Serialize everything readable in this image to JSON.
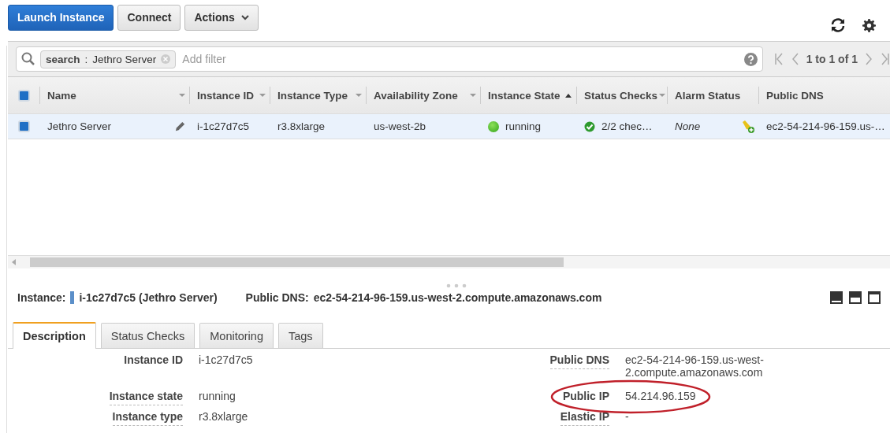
{
  "toolbar": {
    "buttons": [
      {
        "label": "Launch Instance",
        "kind": "primary"
      },
      {
        "label": "Connect",
        "kind": "plain"
      },
      {
        "label": "Actions",
        "kind": "dropdown"
      }
    ]
  },
  "filter": {
    "chip": {
      "key": "search",
      "separator": ":",
      "value": "Jethro Server"
    },
    "placeholder": "Add filter",
    "pagination": "1 to 1 of 1"
  },
  "table": {
    "all_checked": true,
    "columns": [
      {
        "label": "Name",
        "menu": true,
        "sorted_ascending": false
      },
      {
        "label": "Instance ID",
        "menu": true,
        "sorted_ascending": false
      },
      {
        "label": "Instance Type",
        "menu": true,
        "sorted_ascending": false
      },
      {
        "label": "Availability Zone",
        "menu": true,
        "sorted_ascending": false
      },
      {
        "label": "Instance State",
        "menu": false,
        "sorted_ascending": true
      },
      {
        "label": "Status Checks",
        "menu": true,
        "sorted_ascending": false
      },
      {
        "label": "Alarm Status",
        "menu": false,
        "sorted_ascending": false
      },
      {
        "label": "Public DNS",
        "menu": false,
        "sorted_ascending": false
      }
    ],
    "rows": [
      {
        "selected": true,
        "checked": true,
        "cells": [
          {
            "kind": "name",
            "text": "Jethro Server"
          },
          {
            "kind": "text",
            "text": "i-1c27d7c5"
          },
          {
            "kind": "text",
            "text": "r3.8xlarge"
          },
          {
            "kind": "text",
            "text": "us-west-2b"
          },
          {
            "kind": "state",
            "text": "running"
          },
          {
            "kind": "check",
            "text": "2/2 chec…"
          },
          {
            "kind": "alarm",
            "text": "None"
          },
          {
            "kind": "text",
            "text": "ec2-54-214-96-159.us-…"
          }
        ]
      }
    ]
  },
  "details": {
    "instance_label": "Instance:",
    "instance": "i-1c27d7c5 (Jethro Server)",
    "dns_label": "Public DNS:",
    "dns": "ec2-54-214-96-159.us-west-2.compute.amazonaws.com",
    "tabs": [
      {
        "label": "Description",
        "selected": true
      },
      {
        "label": "Status Checks",
        "selected": false
      },
      {
        "label": "Monitoring",
        "selected": false
      },
      {
        "label": "Tags",
        "selected": false
      }
    ],
    "rows": [
      {
        "left": {
          "label": "Instance ID",
          "value": "i-1c27d7c5",
          "underlined": false
        },
        "right": {
          "label": "Public DNS",
          "value": "ec2-54-214-96-159.us-west-2.compute.amazonaws.com",
          "underlined": true,
          "circled": false
        }
      },
      {
        "left": {
          "label": "Instance state",
          "value": "running",
          "underlined": true
        },
        "right": {
          "label": "Public IP",
          "value": "54.214.96.159",
          "underlined": false,
          "circled": true
        }
      },
      {
        "left": {
          "label": "Instance type",
          "value": "r3.8xlarge",
          "underlined": true
        },
        "right": {
          "label": "Elastic IP",
          "value": "-",
          "underlined": true,
          "circled": false
        }
      }
    ]
  }
}
